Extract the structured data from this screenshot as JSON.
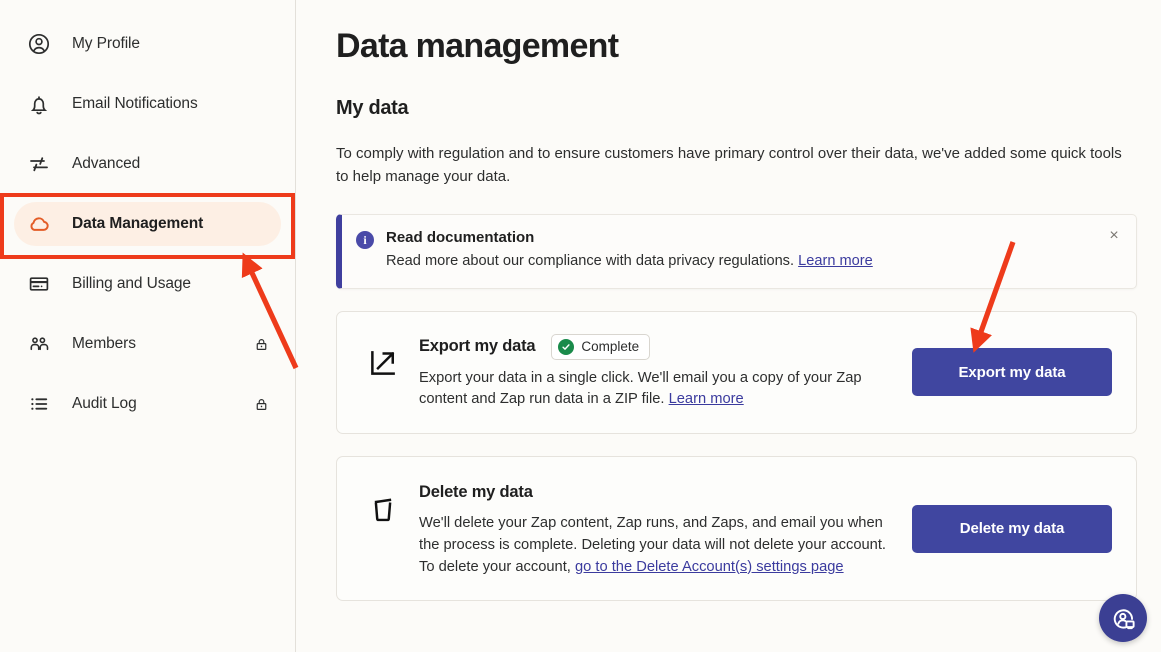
{
  "sidebar": {
    "items": [
      {
        "label": "My Profile",
        "icon": "user-circle-icon",
        "active": false,
        "locked": false
      },
      {
        "label": "Email Notifications",
        "icon": "bell-icon",
        "active": false,
        "locked": false
      },
      {
        "label": "Advanced",
        "icon": "sliders-icon",
        "active": false,
        "locked": false
      },
      {
        "label": "Data Management",
        "icon": "cloud-icon",
        "active": true,
        "locked": false
      },
      {
        "label": "Billing and Usage",
        "icon": "credit-card-icon",
        "active": false,
        "locked": false
      },
      {
        "label": "Members",
        "icon": "users-icon",
        "active": false,
        "locked": true
      },
      {
        "label": "Audit Log",
        "icon": "list-icon",
        "active": false,
        "locked": true
      }
    ]
  },
  "main": {
    "page_title": "Data management",
    "section_title": "My data",
    "section_description": "To comply with regulation and to ensure customers have primary control over their data, we've added some quick tools to help manage your data.",
    "banner": {
      "icon": "info-icon",
      "title": "Read documentation",
      "body": "Read more about our compliance with data privacy regulations.",
      "link_text": "Learn more",
      "close_label": "×",
      "accent_color": "#3F3F9E"
    },
    "cards": [
      {
        "icon": "export-arrow-icon",
        "title": "Export my data",
        "badge": {
          "text": "Complete",
          "icon": "check-circle-icon",
          "color": "#1A8B4B"
        },
        "description": "Export your data in a single click. We'll email you a copy of your Zap content and Zap run data in a ZIP file.",
        "link_text": "Learn more",
        "button_label": "Export my data",
        "button_color": "#4046A0",
        "highlighted": true
      },
      {
        "icon": "trash-icon",
        "title": "Delete my data",
        "badge": null,
        "description": "We'll delete your Zap content, Zap runs, and Zaps, and email you when the process is complete. Deleting your data will not delete your account. To delete your account,",
        "link_text": "go to the Delete Account(s) settings page",
        "button_label": "Delete my data",
        "button_color": "#4046A0",
        "highlighted": false
      }
    ]
  },
  "support": {
    "icon": "support-agent-icon",
    "color": "#3B3F93"
  },
  "annotations": {
    "highlight_color": "#EE3B1B",
    "arrow_color": "#EE3B1B",
    "arrow_count": 2
  }
}
